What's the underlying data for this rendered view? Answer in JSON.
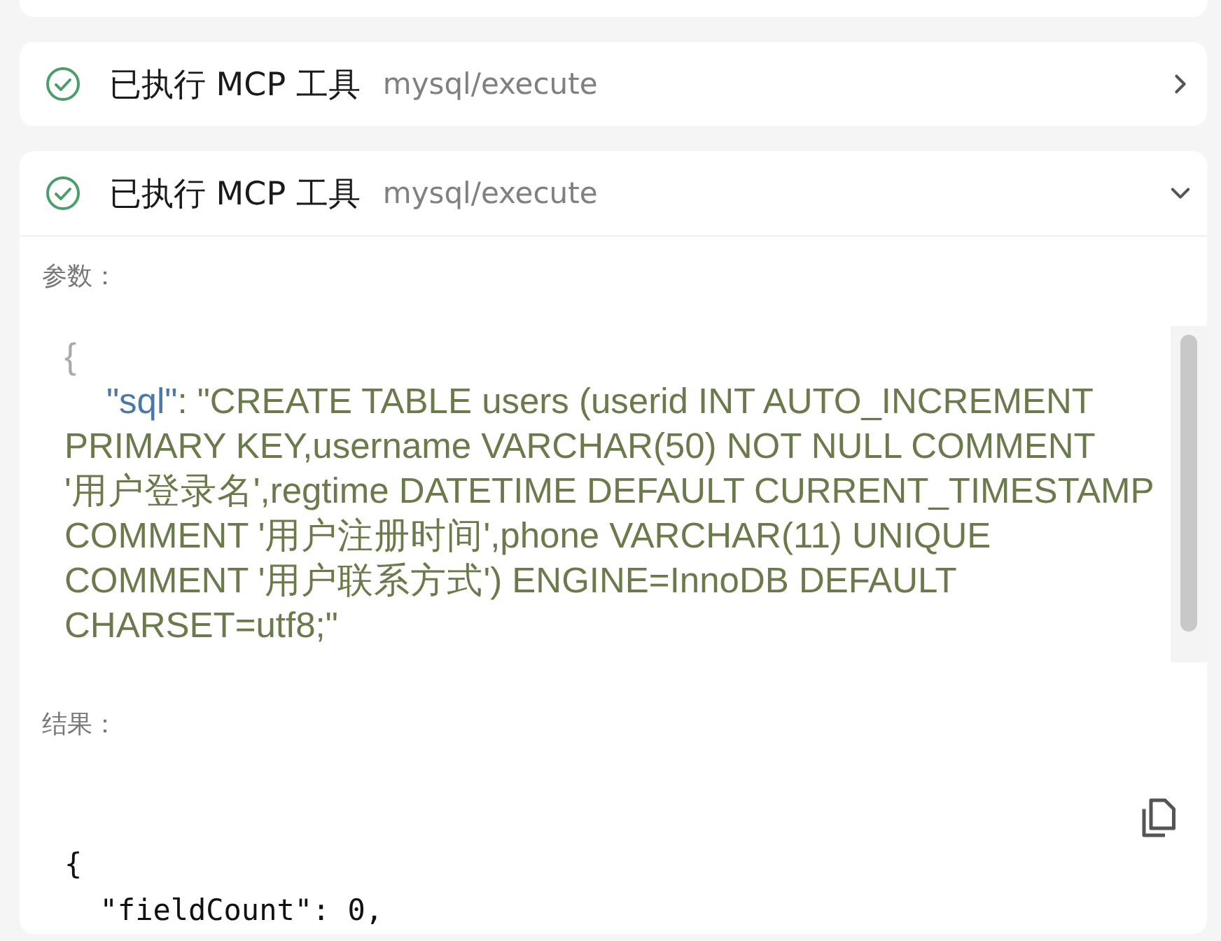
{
  "tool_calls": [
    {
      "done": true,
      "label": "已执行 MCP 工具",
      "tool": "mysql/execute",
      "expanded": false
    },
    {
      "done": true,
      "label": "已执行 MCP 工具",
      "tool": "mysql/execute",
      "expanded": true,
      "params_label": "参数：",
      "params": {
        "open": "{",
        "key": "\"sql\"",
        "sep": ":",
        "value": "\"CREATE TABLE users (userid INT AUTO_INCREMENT PRIMARY KEY,username VARCHAR(50) NOT NULL COMMENT '用户登录名',regtime DATETIME DEFAULT CURRENT_TIMESTAMP COMMENT '用户注册时间',phone VARCHAR(11) UNIQUE COMMENT '用户联系方式') ENGINE=InnoDB DEFAULT CHARSET=utf8;\""
      },
      "result_label": "结果：",
      "result_lines": [
        "{",
        "  \"fieldCount\": 0,"
      ]
    }
  ]
}
